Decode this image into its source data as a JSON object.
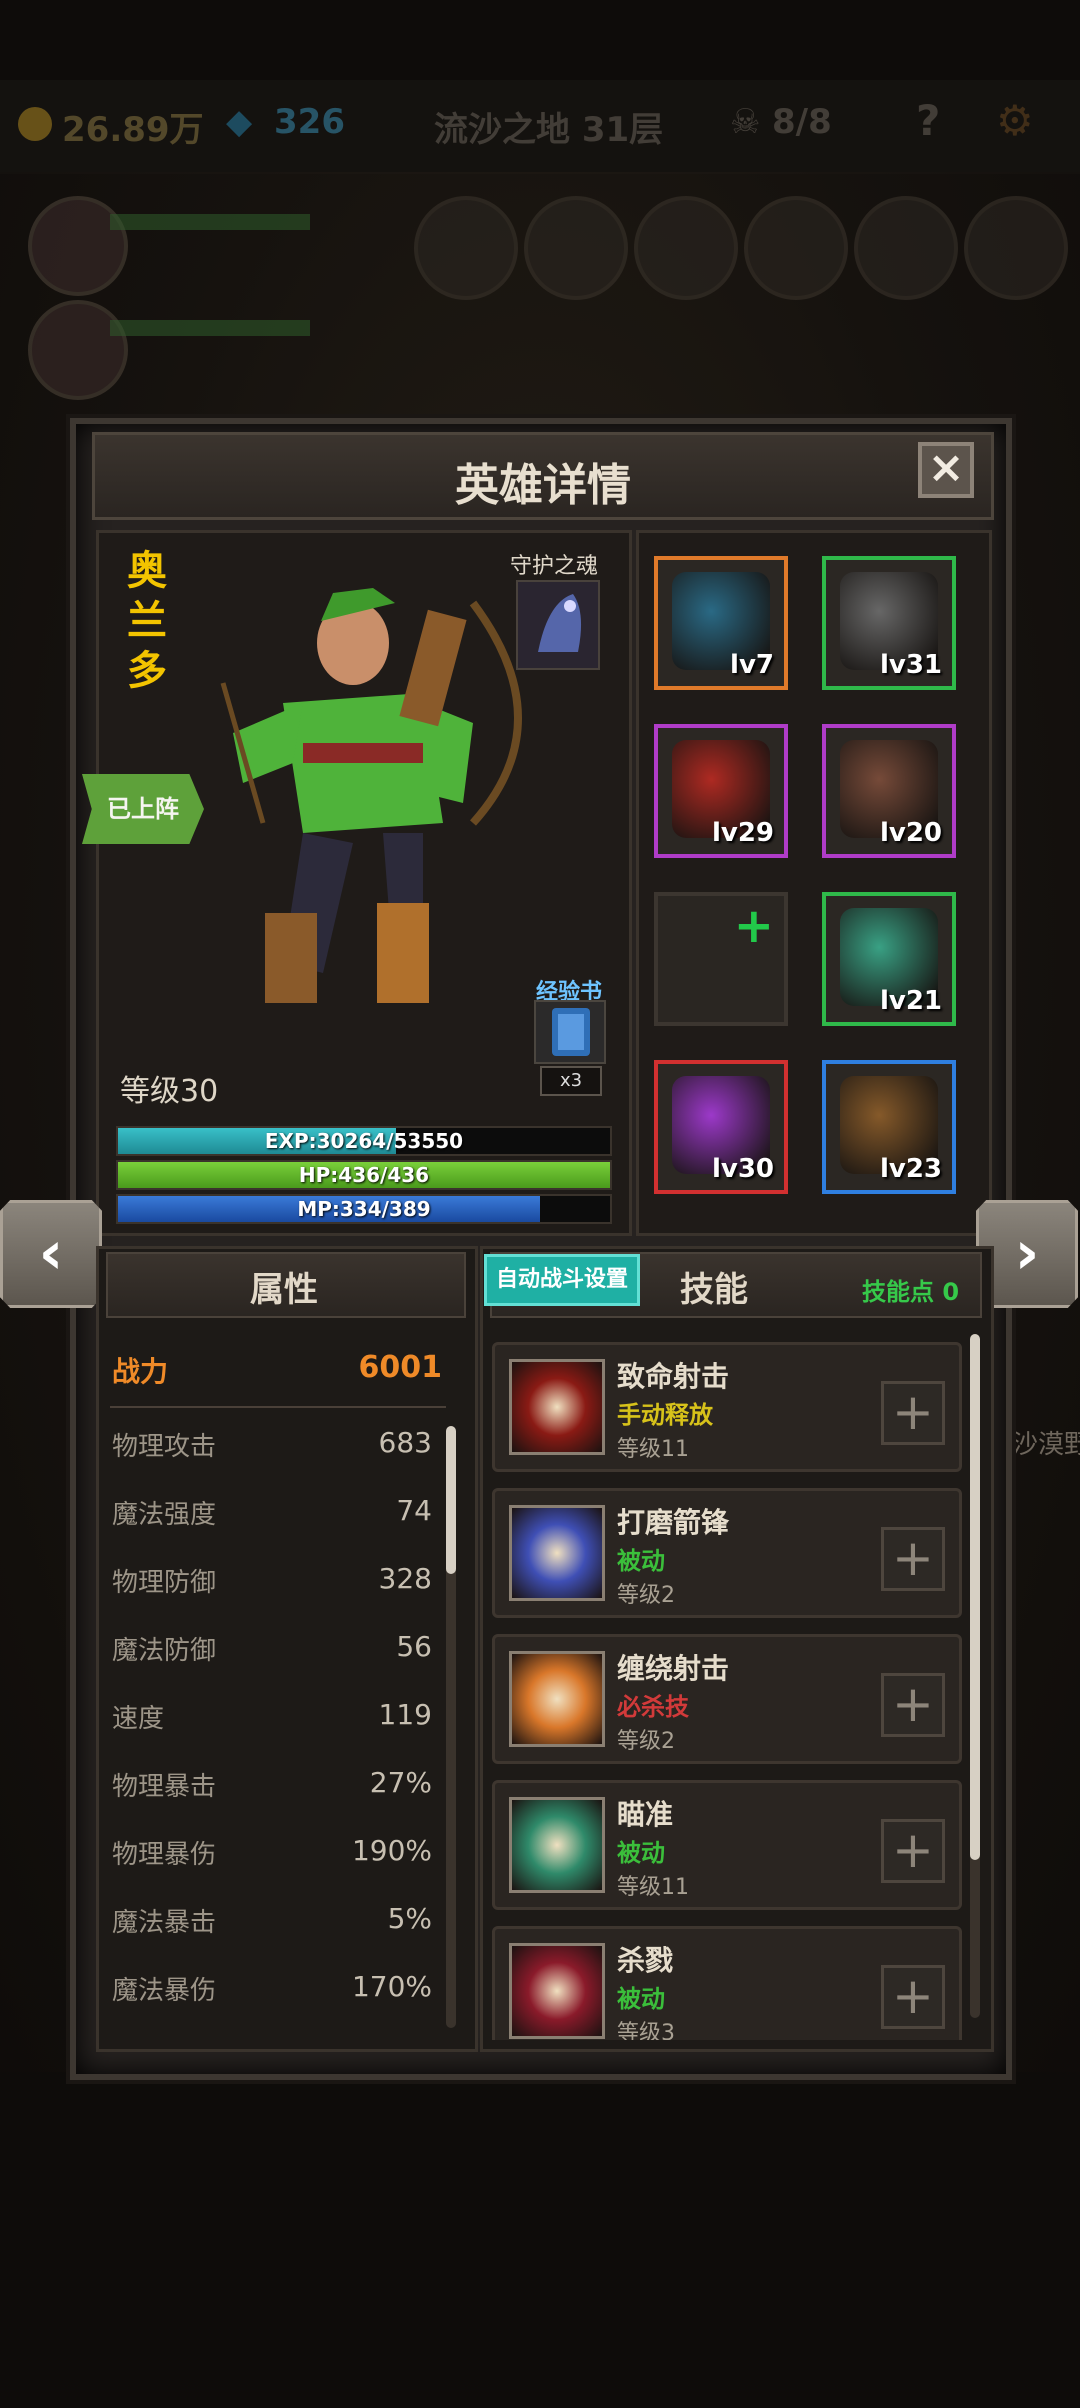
{
  "topbar": {
    "gold": "26.89万",
    "gems": "326",
    "stage": "流沙之地 31层",
    "kills": "8/8",
    "help_icon": "question-icon",
    "settings_icon": "gear-icon"
  },
  "background_text": {
    "enemy_name": "沙漠野"
  },
  "panel": {
    "title": "英雄详情",
    "close_label": "×"
  },
  "hero": {
    "name": "奥兰多",
    "status_tag": "已上阵",
    "level_label": "等级30",
    "guardian_label": "守护之魂",
    "exp_book_label": "经验书",
    "exp_book_count": "x3",
    "exp": {
      "text": "EXP:30264/53550",
      "value": 30264,
      "max": 53550
    },
    "hp": {
      "text": "HP:436/436",
      "value": 436,
      "max": 436
    },
    "mp": {
      "text": "MP:334/389",
      "value": 334,
      "max": 389
    }
  },
  "equipment": [
    {
      "item": "hood",
      "level": "lv7",
      "border": "#e07a2a",
      "color": "#2a6d8a"
    },
    {
      "item": "shoulder-armor",
      "level": "lv31",
      "border": "#2fb94a",
      "color": "#6a6a6a"
    },
    {
      "item": "red-robe",
      "level": "lv29",
      "border": "#b03cc8",
      "color": "#b52a22"
    },
    {
      "item": "gauntlet",
      "level": "lv20",
      "border": "#b03cc8",
      "color": "#7a4c3a"
    },
    {
      "item": "empty-slot",
      "level": "",
      "border": "#3c3630",
      "color": "#2a2622"
    },
    {
      "item": "emerald-ring",
      "level": "lv21",
      "border": "#2fb94a",
      "color": "#3aa789"
    },
    {
      "item": "purple-claws",
      "level": "lv30",
      "border": "#d23030",
      "color": "#a23ad2"
    },
    {
      "item": "wooden-shield",
      "level": "lv23",
      "border": "#2f7fe0",
      "color": "#8a5c2a"
    }
  ],
  "stats": {
    "title": "属性",
    "power": {
      "label": "战力",
      "value": "6001"
    },
    "rows": [
      {
        "label": "物理攻击",
        "value": "683"
      },
      {
        "label": "魔法强度",
        "value": "74"
      },
      {
        "label": "物理防御",
        "value": "328"
      },
      {
        "label": "魔法防御",
        "value": "56"
      },
      {
        "label": "速度",
        "value": "119"
      },
      {
        "label": "物理暴击",
        "value": "27%"
      },
      {
        "label": "物理暴伤",
        "value": "190%"
      },
      {
        "label": "魔法暴击",
        "value": "5%"
      },
      {
        "label": "魔法暴伤",
        "value": "170%"
      }
    ]
  },
  "skills": {
    "title": "技能",
    "auto_battle_button": "自动战斗设置",
    "skill_points": "技能点 0",
    "add_label": "+",
    "list": [
      {
        "name": "致命射击",
        "type": "手动释放",
        "type_color": "#d7c21a",
        "level": "等级11",
        "icon_color": "#8a1a14"
      },
      {
        "name": "打磨箭锋",
        "type": "被动",
        "type_color": "#3bbf3b",
        "level": "等级2",
        "icon_color": "#3f4fb5"
      },
      {
        "name": "缠绕射击",
        "type": "必杀技",
        "type_color": "#d23a3a",
        "level": "等级2",
        "icon_color": "#d9772a"
      },
      {
        "name": "瞄准",
        "type": "被动",
        "type_color": "#3bbf3b",
        "level": "等级11",
        "icon_color": "#2f8a6a"
      },
      {
        "name": "杀戮",
        "type": "被动",
        "type_color": "#3bbf3b",
        "level": "等级3",
        "icon_color": "#8a1a2a"
      }
    ]
  }
}
